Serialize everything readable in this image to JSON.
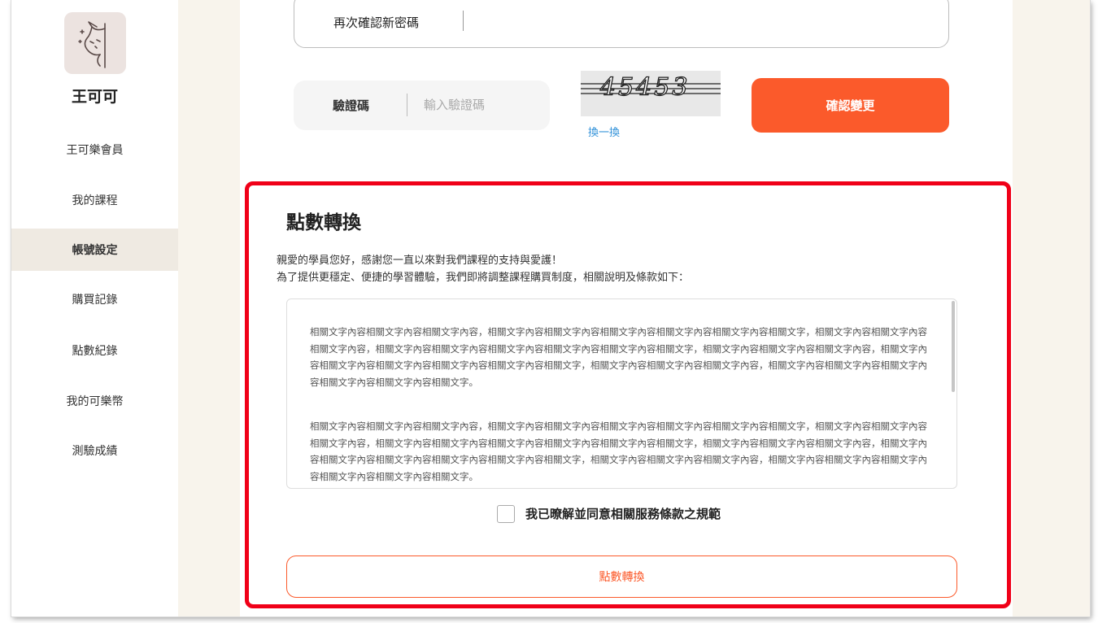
{
  "sidebar": {
    "user_name": "王可可",
    "items": [
      {
        "label": "王可樂會員",
        "active": false
      },
      {
        "label": "我的課程",
        "active": false
      },
      {
        "label": "帳號設定",
        "active": true
      },
      {
        "label": "購買記錄",
        "active": false
      },
      {
        "label": "點數紀錄",
        "active": false
      },
      {
        "label": "我的可樂幣",
        "active": false
      },
      {
        "label": "測驗成績",
        "active": false
      }
    ]
  },
  "password_form": {
    "confirm_new_password_label": "再次確認新密碼",
    "captcha_label": "驗證碼",
    "captcha_placeholder": "輸入驗證碼",
    "captcha_text": "45453",
    "refresh_label": "換一換",
    "confirm_button": "確認變更"
  },
  "points_conversion": {
    "title": "點數轉換",
    "intro_lines": [
      "親愛的學員您好，感謝您一直以來對我們課程的支持與愛護！",
      "為了提供更穩定、便捷的學習體驗，我們即將調整課程購買制度，相關說明及條款如下："
    ],
    "terms_paragraphs": [
      "相關文字內容相關文字內容相關文字內容，相關文字內容相關文字內容相關文字內容相關文字內容相關文字內容相關文字，相關文字內容相關文字內容相關文字內容，相關文字內容相關文字內容相關文字內容相關文字內容相關文字內容相關文字，相關文字內容相關文字內容相關文字內容，相關文字內容相關文字內容相關文字內容相關文字內容相關文字內容相關文字，相關文字內容相關文字內容相關文字內容，相關文字內容相關文字內容相關文字內容相關文字內容相關文字內容相關文字。",
      "相關文字內容相關文字內容相關文字內容，相關文字內容相關文字內容相關文字內容相關文字內容相關文字內容相關文字，相關文字內容相關文字內容相關文字內容，相關文字內容相關文字內容相關文字內容相關文字內容相關文字內容相關文字，相關文字內容相關文字內容相關文字內容，相關文字內容相關文字內容相關文字內容相關文字內容相關文字內容相關文字，相關文字內容相關文字內容相關文字內容，相關文字內容相關文字內容相關文字內容相關文字內容相關文字內容相關文字。"
    ],
    "agree_label": "我已暸解並同意相關服務條款之規範",
    "convert_button": "點數轉換"
  },
  "colors": {
    "accent": "#fb5a2b",
    "highlight": "#f00018",
    "link": "#2d8fd8",
    "page_bg": "#f8f4ec"
  }
}
